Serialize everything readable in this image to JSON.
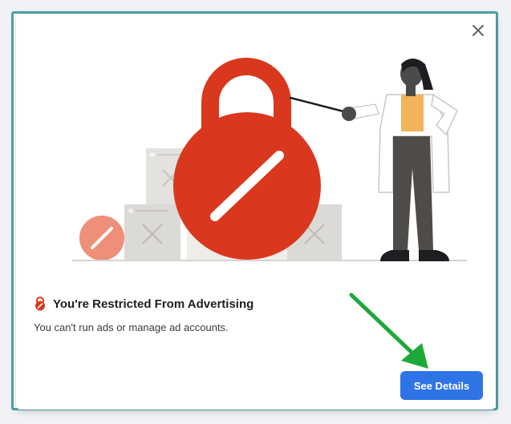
{
  "dialog": {
    "title": "You're Restricted From Advertising",
    "subtitle": "You can't run ads or manage ad accounts.",
    "primary_button_label": "See Details",
    "close_icon": "close-icon",
    "title_icon": "restricted-lock-icon"
  },
  "illustration": {
    "icon": "restricted-lock-illustration"
  },
  "annotation": {
    "icon": "green-arrow-icon",
    "color": "#1ea83a"
  },
  "colors": {
    "primary_button": "#2f74e6",
    "lock_red": "#d9381e",
    "frame_border": "#4fa4a8"
  }
}
